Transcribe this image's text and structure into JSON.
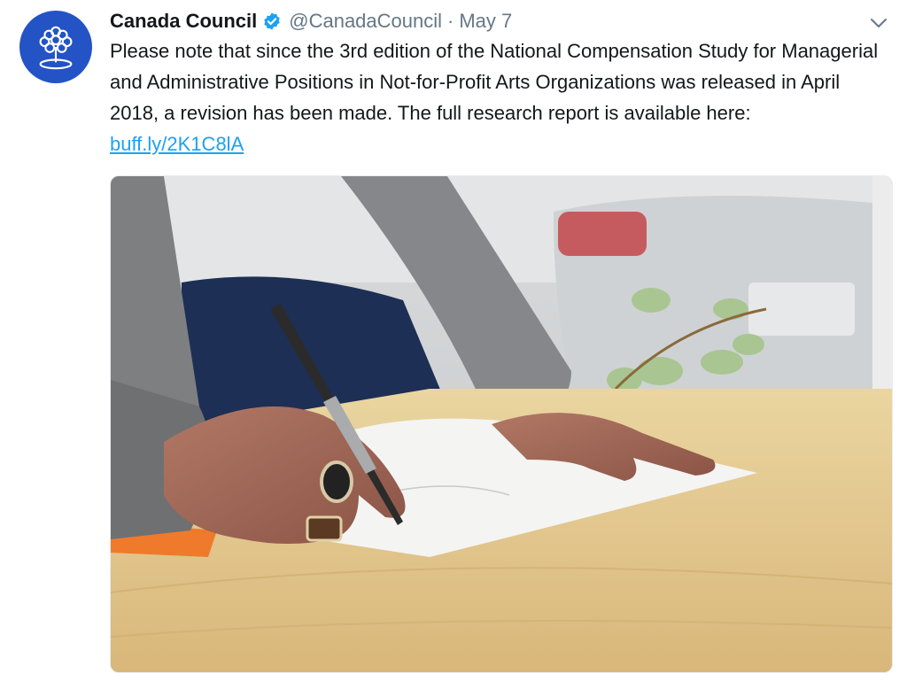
{
  "tweet": {
    "author_name": "Canada Council",
    "handle": "@CanadaCouncil",
    "separator": "·",
    "date": "May 7",
    "text_before_link": "Please note that since the 3rd edition of the National Compensation Study for Managerial and Administrative Positions in Not-for-Profit Arts Organizations was released in April 2018, a revision has been made. The full research report is available here: ",
    "link_text": "buff.ly/2K1C8lA"
  },
  "colors": {
    "avatar_bg": "#2453c6",
    "verified": "#1da1f2",
    "link": "#1da1f2",
    "meta_text": "#657786"
  },
  "icons": {
    "avatar": "tree-logo-icon",
    "verified": "verified-badge-icon",
    "caret": "chevron-down-icon"
  }
}
